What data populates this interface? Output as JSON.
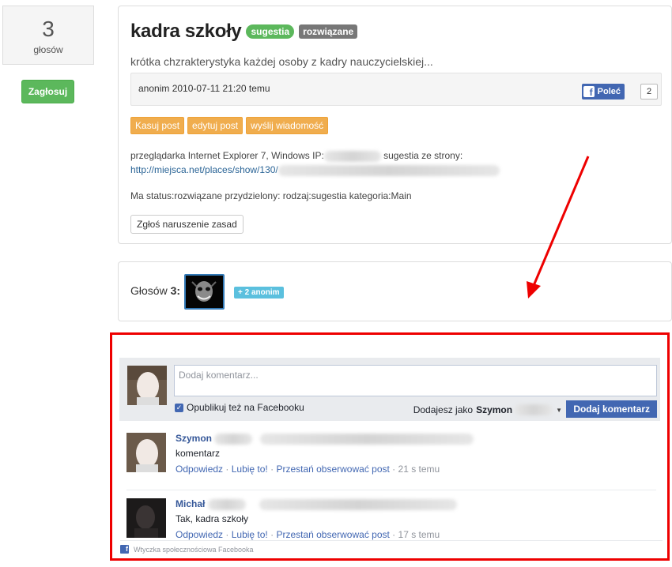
{
  "vote": {
    "count": "3",
    "label": "głosów",
    "button": "Zagłosuj"
  },
  "post": {
    "title": "kadra szkoły",
    "badges": [
      "sugestia",
      "rozwiązane"
    ],
    "description": "krótka chzrakterystyka każdej osoby z kadry nauczycielskiej...",
    "author_line": "anonim 2010-07-11 21:20 temu",
    "fb_like_label": "Poleć",
    "fb_like_count": "2",
    "actions": [
      "Kasuj post",
      "edytuj post",
      "wyślij wiadomość"
    ],
    "browser_info_prefix": "przeglądarka Internet Explorer 7, Windows IP:",
    "browser_info_suffix": "sugestia ze strony:",
    "source_url": "http://miejsca.net/places/show/130/",
    "status_line": "Ma status:rozwiązane przydzielony: rodzaj:sugestia kategoria:Main",
    "report_button": "Zgłoś naruszenie zasad"
  },
  "votes": {
    "label": "Głosów",
    "count": "3",
    "anon_badge": "+ 2 anonim"
  },
  "fb_comments": {
    "placeholder": "Dodaj komentarz...",
    "publish_label": "Opublikuj też na Facebooku",
    "posting_as_prefix": "Dodajesz jako",
    "posting_as_name": "Szymon",
    "add_button": "Dodaj komentarz",
    "comments": [
      {
        "author": "Szymon",
        "text": "komentarz",
        "reply": "Odpowiedz",
        "like": "Lubię to!",
        "unfollow": "Przestań obserwować post",
        "time": "21 s temu"
      },
      {
        "author": "Michał",
        "text": "Tak, kadra szkoły",
        "reply": "Odpowiedz",
        "like": "Lubię to!",
        "unfollow": "Przestań obserwować post",
        "time": "17 s temu"
      }
    ],
    "footer": "Wtyczka społecznościowa Facebooka"
  },
  "colors": {
    "highlight_frame": "#ee0000",
    "fb_blue": "#4267b2",
    "success": "#5cb85c",
    "warning": "#f0ad4e"
  }
}
